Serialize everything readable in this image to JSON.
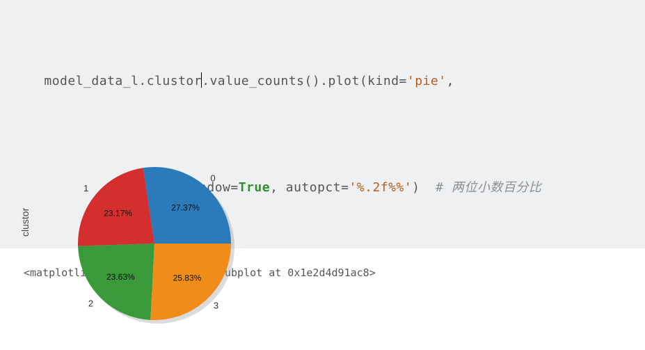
{
  "code": {
    "line1_a": "model_data_l.clustor",
    "line1_b": ".value_counts().plot(kind=",
    "line1_str": "'pie'",
    "line1_c": ",",
    "line2_a": "shadow=",
    "line2_kw": "True",
    "line2_b": ", autopct=",
    "line2_str": "'%.2f%%'",
    "line2_c": ")  ",
    "line2_comment": "# 两位小数百分比"
  },
  "output_repr": "<matplotlib.axes._subplots.AxesSubplot at 0x1e2d4d91ac8>",
  "chart_data": {
    "type": "pie",
    "ylabel": "clustor",
    "categories": [
      "0",
      "1",
      "2",
      "3"
    ],
    "values": [
      27.37,
      23.17,
      23.63,
      25.83
    ],
    "autopct_labels": [
      "27.37%",
      "23.17%",
      "23.63%",
      "25.83%"
    ],
    "colors": [
      "#2b7bba",
      "#d32f2f",
      "#3a9a3a",
      "#f08c1a"
    ],
    "shadow": true
  }
}
